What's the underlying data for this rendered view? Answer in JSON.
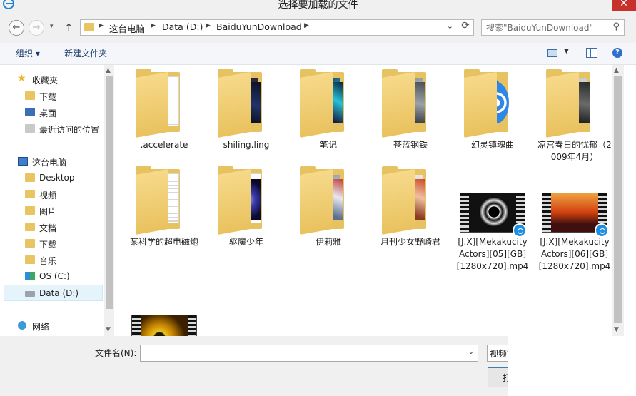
{
  "window": {
    "title": "选择要加载的文件",
    "close_glyph": "✕"
  },
  "nav": {
    "back_glyph": "←",
    "forward_glyph": "→",
    "up_glyph": "↑",
    "dropdown_glyph": "▾",
    "crumbs": [
      "这台电脑",
      "Data (D:)",
      "BaiduYunDownload"
    ],
    "sep_glyph": "▶",
    "address_dropdown_glyph": "⌄",
    "refresh_glyph": "⟳"
  },
  "search": {
    "placeholder": "搜索\"BaiduYunDownload\"",
    "icon_glyph": "⚲"
  },
  "toolbar": {
    "organize": "组织 ▾",
    "new_folder": "新建文件夹",
    "view_dropdown": "▼",
    "help_glyph": "?"
  },
  "sidebar": {
    "favorites": "收藏夹",
    "fav_items": [
      "下载",
      "桌面",
      "最近访问的位置"
    ],
    "this_pc": "这台电脑",
    "pc_items": [
      "Desktop",
      "视频",
      "图片",
      "文档",
      "下载",
      "音乐",
      "OS (C:)",
      "Data (D:)"
    ],
    "network": "网络",
    "selected": "Data (D:)",
    "star_glyph": "★",
    "scroll_up": "▲",
    "scroll_down": "▼"
  },
  "content": {
    "row1": [
      ".accelerate",
      "shiling.ling",
      "笔记",
      "苍蓝钢铁",
      "幻灵镇魂曲",
      "凉宫春日的忧郁（2009年4月）"
    ],
    "row2": [
      "某科学的超电磁炮",
      "驱魔少年",
      "伊莉雅",
      "月刊少女野崎君",
      "[J.X][Mekakucity Actors][05][GB][1280x720].mp4",
      "[J.X][Mekakucity Actors][06][GB][1280x720].mp4"
    ],
    "scroll_up": "▲",
    "scroll_down": "▼"
  },
  "bottom": {
    "filename_label": "文件名(N):",
    "filename_value": "",
    "filetype": "视频文件",
    "open_button": "打开(O)",
    "dropdown_glyph": "⌄"
  }
}
